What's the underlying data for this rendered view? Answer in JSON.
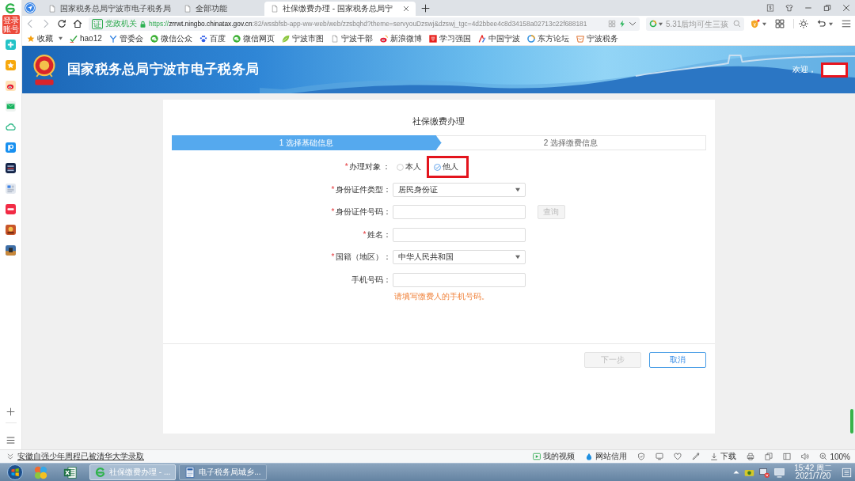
{
  "sidebar": {
    "badge": "登录账号"
  },
  "tabs": [
    {
      "title": "国家税务总局宁波市电子税务局",
      "selected": false
    },
    {
      "title": "全部功能",
      "selected": false
    },
    {
      "title": "社保缴费办理 - 国家税务总局宁",
      "selected": true
    }
  ],
  "address": {
    "badge_glyph": "证",
    "badge": "党政机关",
    "scheme": "https://",
    "host": "zrrwt.ningbo.chinatax.gov.cn",
    "path": ":82/wssbfsb-app-ww-web/web/zzsbqhd?theme=servyouDzswj&dzswj_tgc=4d2bbee4c8d34158a02713c22f688181"
  },
  "search": {
    "placeholder": "5.31后均可生三孩"
  },
  "bookmarks": {
    "favorites": "收藏",
    "items": [
      {
        "label": "hao12"
      },
      {
        "label": "管委会"
      },
      {
        "label": "微信公众"
      },
      {
        "label": "百度"
      },
      {
        "label": "微信网页"
      },
      {
        "label": "宁波市图"
      },
      {
        "label": "宁波干部"
      },
      {
        "label": "新浪微博"
      },
      {
        "label": "学习强国"
      },
      {
        "label": "中国宁波"
      },
      {
        "label": "东方论坛"
      },
      {
        "label": "宁波税务"
      }
    ]
  },
  "site": {
    "title": "国家税务总局宁波市电子税务局",
    "welcome": "欢迎，",
    "user_redacted": true
  },
  "form": {
    "title": "社保缴费办理",
    "steps": [
      {
        "label": "1 选择基础信息",
        "selected": true
      },
      {
        "label": "2 选择缴费信息",
        "selected": false
      }
    ],
    "fields": [
      {
        "kind": "radio",
        "mark": "*",
        "label": "办理对象 ：",
        "options": [
          {
            "label": "本人",
            "selected": false,
            "highlighted": false
          },
          {
            "label": "他人",
            "selected": true,
            "highlighted": true
          }
        ]
      },
      {
        "kind": "select",
        "mark": "*",
        "label": "身份证件类型：",
        "value": "居民身份证"
      },
      {
        "kind": "input",
        "mark": "*",
        "label": "身份证件号码：",
        "button": {
          "label": "查询",
          "disabled": true
        }
      },
      {
        "kind": "input",
        "mark": "*",
        "label": "姓名："
      },
      {
        "kind": "select",
        "mark": "*",
        "label": "国籍（地区）：",
        "value": "中华人民共和国"
      },
      {
        "kind": "input",
        "label": "手机号码：",
        "hint": "请填写缴费人的手机号码。"
      }
    ],
    "buttons": [
      {
        "label": "下一步",
        "disabled": true
      },
      {
        "label": "取消",
        "disabled": false
      }
    ]
  },
  "status_bar": {
    "news": "安徽自强少年周程已被清华大学录取",
    "video": "我的视频",
    "credit": "网站信用",
    "download": "下载",
    "zoom": "100%"
  },
  "taskbar": {
    "windows": [
      {
        "title": "社保缴费办理 - ...",
        "selected": true
      },
      {
        "title": "电子税务局城乡...",
        "selected": false
      }
    ],
    "time": "15:42 周二",
    "date": "2021/7/20"
  }
}
